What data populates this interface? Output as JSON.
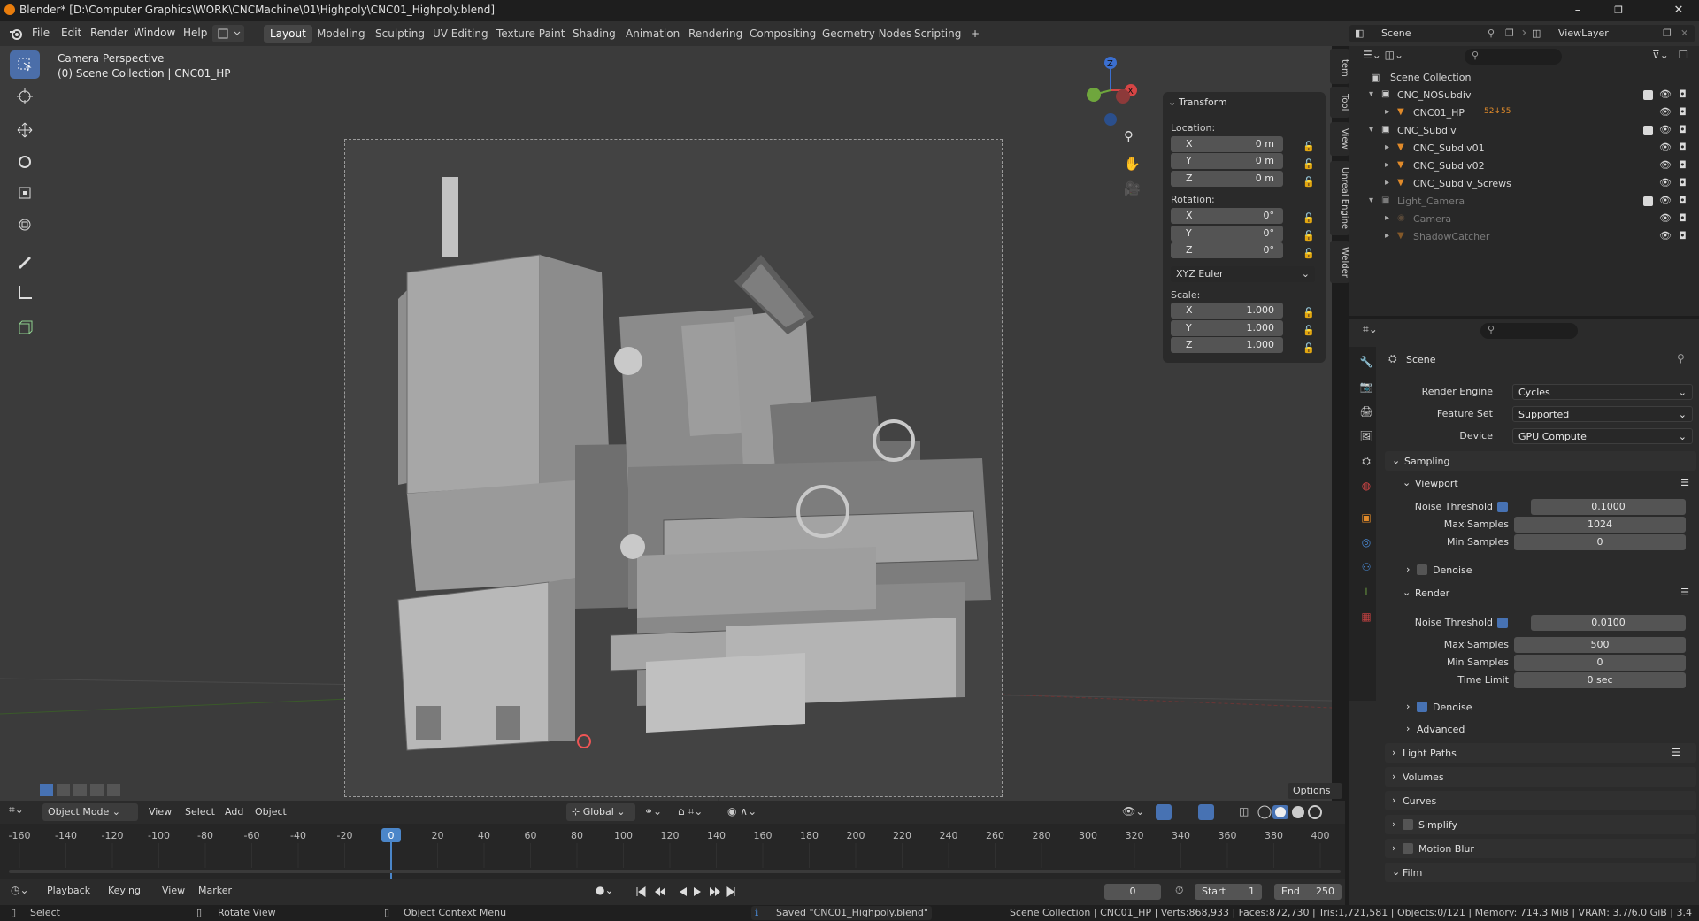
{
  "titlebar": {
    "title": "Blender* [D:\\Computer Graphics\\WORK\\CNCMachine\\01\\Highpoly\\CNC01_Highpoly.blend]",
    "minimize": "–",
    "maximize": "❐",
    "close": "✕"
  },
  "menu": [
    "File",
    "Edit",
    "Render",
    "Window",
    "Help"
  ],
  "workspaces": [
    "Layout",
    "Modeling",
    "Sculpting",
    "UV Editing",
    "Texture Paint",
    "Shading",
    "Animation",
    "Rendering",
    "Compositing",
    "Geometry Nodes",
    "Scripting",
    "+"
  ],
  "active_workspace": "Layout",
  "scene_selector": {
    "label": "Scene",
    "viewlayer": "ViewLayer"
  },
  "viewport": {
    "mode_text": "Camera Perspective",
    "collection_text": "(0) Scene Collection | CNC01_HP",
    "options": "Options"
  },
  "npanel": {
    "title": "Transform",
    "location_label": "Location:",
    "location": [
      {
        "axis": "X",
        "value": "0 m"
      },
      {
        "axis": "Y",
        "value": "0 m"
      },
      {
        "axis": "Z",
        "value": "0 m"
      }
    ],
    "rotation_label": "Rotation:",
    "rotation": [
      {
        "axis": "X",
        "value": "0°"
      },
      {
        "axis": "Y",
        "value": "0°"
      },
      {
        "axis": "Z",
        "value": "0°"
      }
    ],
    "rotation_mode": "XYZ Euler",
    "scale_label": "Scale:",
    "scale": [
      {
        "axis": "X",
        "value": "1.000"
      },
      {
        "axis": "Y",
        "value": "1.000"
      },
      {
        "axis": "Z",
        "value": "1.000"
      }
    ],
    "tabs": [
      "Item",
      "Tool",
      "View",
      "Unreal Engine",
      "Welder"
    ]
  },
  "header2": {
    "mode": "Object Mode",
    "menus": [
      "View",
      "Select",
      "Add",
      "Object"
    ],
    "orientation": "Global"
  },
  "timeline": {
    "ticks": [
      "-160",
      "-140",
      "-120",
      "-100",
      "-80",
      "-60",
      "-40",
      "-20",
      "0",
      "20",
      "40",
      "60",
      "80",
      "100",
      "120",
      "140",
      "160",
      "180",
      "200",
      "220",
      "240",
      "260",
      "280",
      "300",
      "320",
      "340",
      "360",
      "380",
      "400"
    ],
    "current_frame": "0"
  },
  "playbar": {
    "menus": [
      "Playback",
      "Keying",
      "View",
      "Marker"
    ],
    "frame": "0",
    "start_label": "Start",
    "start": "1",
    "end_label": "End",
    "end": "250"
  },
  "status": {
    "select": "Select",
    "rotate": "Rotate View",
    "context": "Object Context Menu",
    "message": "Saved \"CNC01_Highpoly.blend\"",
    "stats": "Scene Collection | CNC01_HP | Verts:868,933 | Faces:872,730 | Tris:1,721,581 | Objects:0/121 | Memory: 714.3 MiB | VRAM: 3.7/6.0 GiB | 3.4"
  },
  "outliner": {
    "root": "Scene Collection",
    "rows": [
      {
        "label": "CNC_NOSubdiv",
        "indent": 1,
        "type": "collection",
        "dim": false
      },
      {
        "label": "CNC01_HP",
        "indent": 2,
        "type": "object",
        "dim": false,
        "extra": "52↓55"
      },
      {
        "label": "CNC_Subdiv",
        "indent": 1,
        "type": "collection",
        "dim": false
      },
      {
        "label": "CNC_Subdiv01",
        "indent": 2,
        "type": "object",
        "dim": false
      },
      {
        "label": "CNC_Subdiv02",
        "indent": 2,
        "type": "object",
        "dim": false
      },
      {
        "label": "CNC_Subdiv_Screws",
        "indent": 2,
        "type": "object",
        "dim": false
      },
      {
        "label": "Light_Camera",
        "indent": 1,
        "type": "collection",
        "dim": true
      },
      {
        "label": "Camera",
        "indent": 2,
        "type": "camera",
        "dim": true
      },
      {
        "label": "ShadowCatcher",
        "indent": 2,
        "type": "object",
        "dim": true
      }
    ]
  },
  "props": {
    "scene_label": "Scene",
    "render_engine_label": "Render Engine",
    "render_engine": "Cycles",
    "feature_set_label": "Feature Set",
    "feature_set": "Supported",
    "device_label": "Device",
    "device": "GPU Compute",
    "sampling": "Sampling",
    "viewport": "Viewport",
    "noise_threshold_label": "Noise Threshold",
    "vp_noise": "0.1000",
    "max_samples_label": "Max Samples",
    "vp_max": "1024",
    "min_samples_label": "Min Samples",
    "vp_min": "0",
    "denoise": "Denoise",
    "render": "Render",
    "r_noise": "0.0100",
    "r_max": "500",
    "r_min": "0",
    "time_limit_label": "Time Limit",
    "r_time": "0 sec",
    "advanced": "Advanced",
    "light_paths": "Light Paths",
    "volumes": "Volumes",
    "curves": "Curves",
    "simplify": "Simplify",
    "motion_blur": "Motion Blur",
    "film": "Film"
  },
  "colors": {
    "accent": "#4772b3",
    "active_tool": "#4b6ea9",
    "playhead": "#4b86c9"
  }
}
